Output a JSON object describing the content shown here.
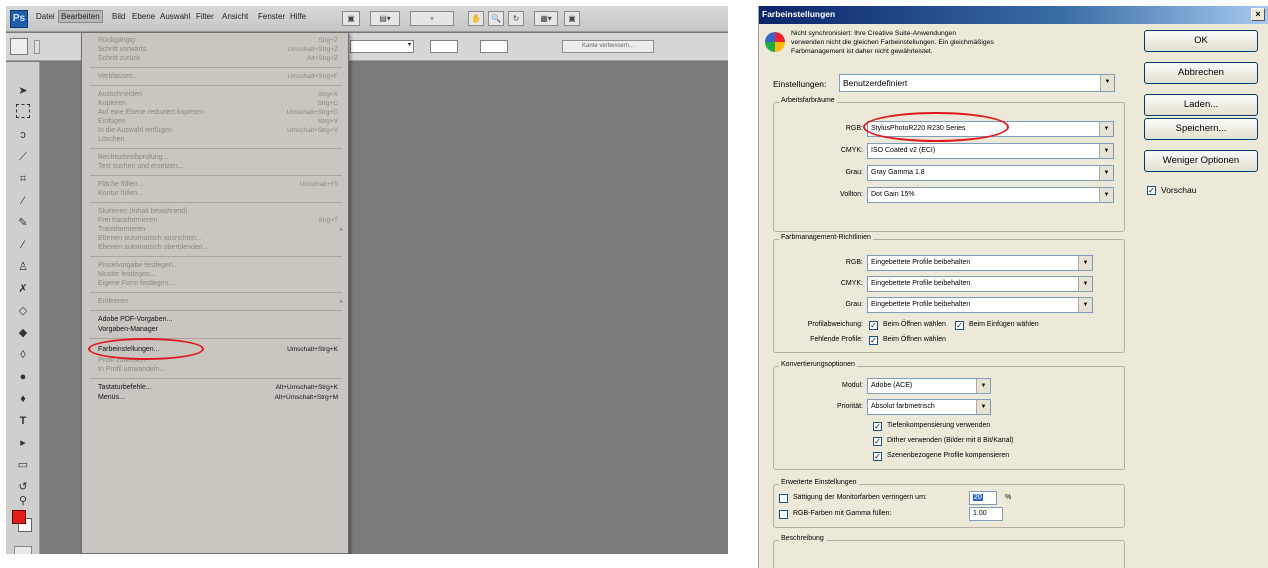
{
  "photoshop": {
    "menubar": {
      "items": [
        "Datei",
        "Bearbeiten",
        "Bild",
        "Ebene",
        "Auswahl",
        "Filter",
        "Ansicht",
        "Fenster",
        "Hilfe"
      ]
    },
    "optbar": {
      "refine_edge_label": "Kante verbessern..."
    },
    "edit_menu": {
      "items": [
        {
          "label": "Rückgängig",
          "shortcut": "Strg+Z",
          "enabled": false
        },
        {
          "label": "Schritt vorwärts",
          "shortcut": "Umschalt+Strg+Z",
          "enabled": false
        },
        {
          "label": "Schritt zurück",
          "shortcut": "Alt+Strg+Z",
          "enabled": false
        },
        {
          "label": "Verblassen...",
          "shortcut": "Umschalt+Strg+F",
          "enabled": false
        },
        {
          "label": "Ausschneiden",
          "shortcut": "Strg+X",
          "enabled": false
        },
        {
          "label": "Kopieren",
          "shortcut": "Strg+C",
          "enabled": false
        },
        {
          "label": "Auf eine Ebene reduziert kopieren",
          "shortcut": "Umschalt+Strg+C",
          "enabled": false
        },
        {
          "label": "Einfügen",
          "shortcut": "Strg+V",
          "enabled": false
        },
        {
          "label": "In die Auswahl einfügen",
          "shortcut": "Umschalt+Strg+V",
          "enabled": false
        },
        {
          "label": "Löschen",
          "shortcut": "",
          "enabled": false
        },
        {
          "label": "Rechtschreibprüfung...",
          "shortcut": "",
          "enabled": false
        },
        {
          "label": "Text suchen und ersetzen...",
          "shortcut": "",
          "enabled": false
        },
        {
          "label": "Fläche füllen...",
          "shortcut": "Umschalt+F5",
          "enabled": false
        },
        {
          "label": "Kontur füllen...",
          "shortcut": "",
          "enabled": false
        },
        {
          "label": "Skalieren (Inhalt bewahrend)",
          "shortcut": "",
          "enabled": false
        },
        {
          "label": "Frei transformieren",
          "shortcut": "Strg+T",
          "enabled": false
        },
        {
          "label": "Transformieren",
          "shortcut": "",
          "enabled": false,
          "submenu": true
        },
        {
          "label": "Ebenen automatisch ausrichten...",
          "shortcut": "",
          "enabled": false
        },
        {
          "label": "Ebenen automatisch überblenden...",
          "shortcut": "",
          "enabled": false
        },
        {
          "label": "Pinselvorgabe festlegen...",
          "shortcut": "",
          "enabled": false
        },
        {
          "label": "Muster festlegen...",
          "shortcut": "",
          "enabled": false
        },
        {
          "label": "Eigene Form festlegen...",
          "shortcut": "",
          "enabled": false
        },
        {
          "label": "Entleeren",
          "shortcut": "",
          "enabled": false,
          "submenu": true
        },
        {
          "label": "Adobe PDF-Vorgaben...",
          "shortcut": "",
          "enabled": true
        },
        {
          "label": "Vorgaben-Manager",
          "shortcut": "",
          "enabled": true
        },
        {
          "label": "Farbeinstellungen...",
          "shortcut": "Umschalt+Strg+K",
          "enabled": true
        },
        {
          "label": "Profil zuweisen...",
          "shortcut": "",
          "enabled": false
        },
        {
          "label": "In Profil umwandeln...",
          "shortcut": "",
          "enabled": false
        },
        {
          "label": "Tastaturbefehle...",
          "shortcut": "Alt+Umschalt+Strg+K",
          "enabled": true
        },
        {
          "label": "Menüs...",
          "shortcut": "Alt+Umschalt+Strg+M",
          "enabled": true
        }
      ]
    },
    "colors": {
      "foreground": "#e21b1b",
      "background": "#ffffff",
      "canvas": "#7b7b7b",
      "highlight": "#e0161c"
    }
  },
  "dialog": {
    "title": "Farbeinstellungen",
    "close": "×",
    "warning": {
      "line1": "Nicht synchronisiert: Ihre Creative Suite-Anwendungen",
      "line2": "verwenden nicht die gleichen Farbeinstellungen. Ein gleichmäßiges",
      "line3": "Farbmanagement ist daher nicht gewährleistet."
    },
    "settings_label": "Einstellungen:",
    "settings_value": "Benutzerdefiniert",
    "workspaces": {
      "title": "Arbeitsfarbräume",
      "rgb_label": "RGB:",
      "rgb_value": "StylusPhotoR220 R230 Series",
      "cmyk_label": "CMYK:",
      "cmyk_value": "ISO Coated v2 (ECI)",
      "gray_label": "Grau:",
      "gray_value": "Gray Gamma 1.8",
      "spot_label": "Vollton:",
      "spot_value": "Dot Gain 15%"
    },
    "policies": {
      "title": "Farbmanagement-Richtlinien",
      "rgb_label": "RGB:",
      "rgb_value": "Eingebettete Profile beibehalten",
      "cmyk_label": "CMYK:",
      "cmyk_value": "Eingebettete Profile beibehalten",
      "gray_label": "Grau:",
      "gray_value": "Eingebettete Profile beibehalten",
      "mismatch_label": "Profilabweichung:",
      "mismatch_open": "Beim Öffnen wählen",
      "mismatch_paste": "Beim Einfügen wählen",
      "missing_label": "Fehlende Profile:",
      "missing_open": "Beim Öffnen wählen"
    },
    "conversion": {
      "title": "Konvertierungsoptionen",
      "engine_label": "Modul:",
      "engine_value": "Adobe (ACE)",
      "intent_label": "Priorität:",
      "intent_value": "Absolut farbmetrisch",
      "bpc": "Tiefenkompensierung verwenden",
      "dither": "Dither verwenden (Bilder mit 8 Bit/Kanal)",
      "scene": "Szenenbezogene Profile kompensieren"
    },
    "advanced": {
      "title": "Erweiterte Einstellungen",
      "desaturate": "Sättigung der Monitorfarben verringern um:",
      "desaturate_value": "20",
      "desaturate_unit": "%",
      "blend": "RGB-Farben mit Gamma füllen:",
      "blend_value": "1.00"
    },
    "description": {
      "title": "Beschreibung"
    },
    "buttons": {
      "ok": "OK",
      "cancel": "Abbrechen",
      "load": "Laden...",
      "save": "Speichern...",
      "fewer": "Weniger Optionen"
    },
    "preview_label": "Vorschau",
    "colors": {
      "title_bar": "#0a246a",
      "face": "#ece9d8",
      "highlight": "#e0161c"
    }
  }
}
